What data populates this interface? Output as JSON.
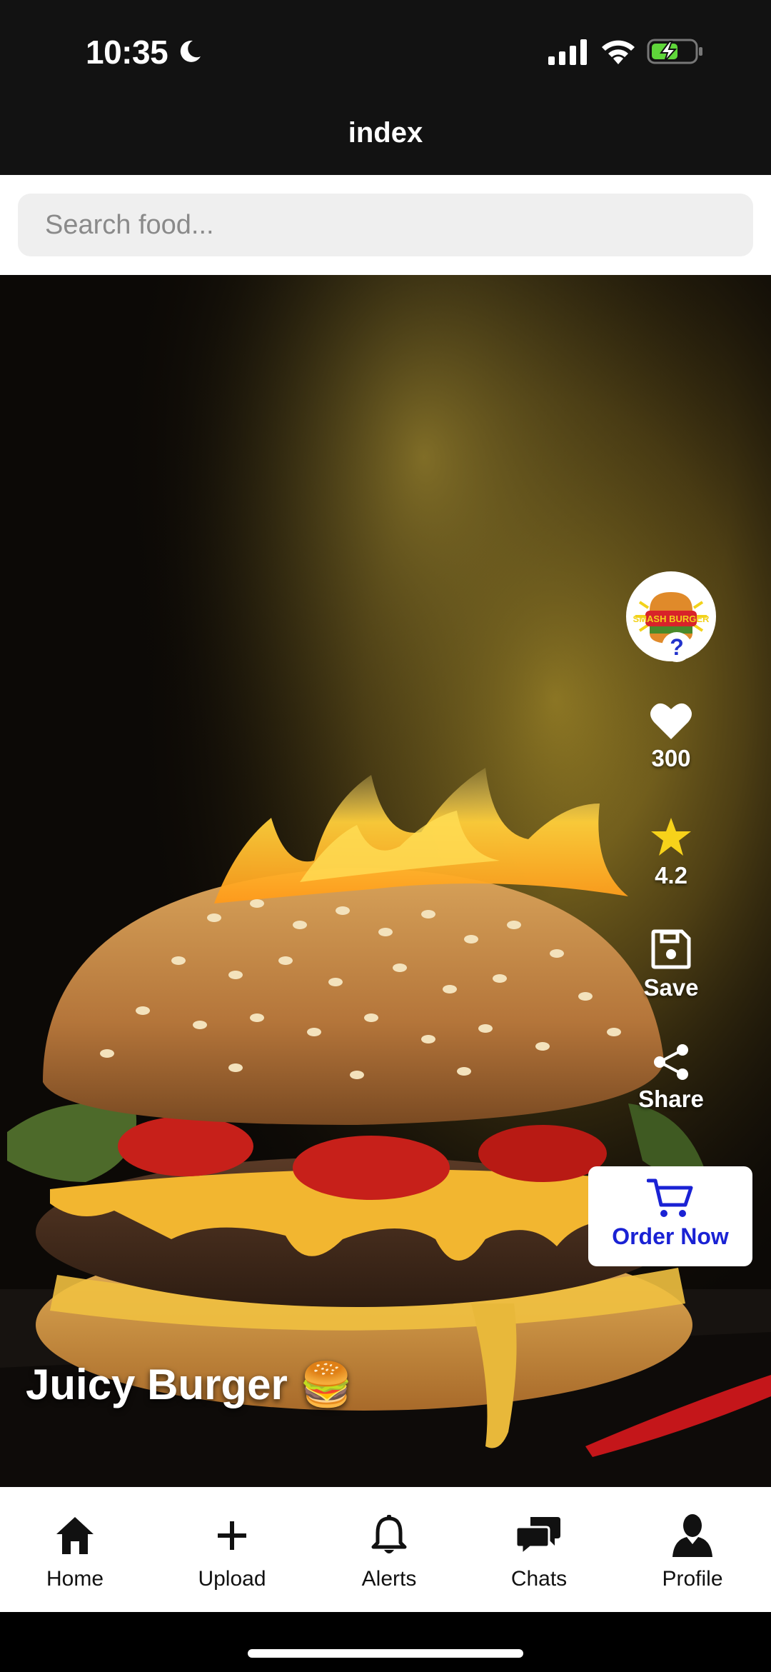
{
  "status_bar": {
    "time": "10:35"
  },
  "header": {
    "title": "index"
  },
  "search": {
    "placeholder": "Search food..."
  },
  "post": {
    "title": "Juicy Burger 🍔",
    "avatar_badge": "?",
    "avatar_logo_text": "SMASH BURGER",
    "likes": "300",
    "rating": "4.2",
    "save_label": "Save",
    "share_label": "Share",
    "order_label": "Order Now"
  },
  "tabs": [
    {
      "label": "Home",
      "icon": "home-icon"
    },
    {
      "label": "Upload",
      "icon": "plus-icon"
    },
    {
      "label": "Alerts",
      "icon": "bell-icon"
    },
    {
      "label": "Chats",
      "icon": "chat-icon"
    },
    {
      "label": "Profile",
      "icon": "person-icon"
    }
  ],
  "colors": {
    "accent": "#1a22d4",
    "star": "#f7d21a",
    "header_bg": "#121212",
    "battery": "#5fd63a"
  }
}
